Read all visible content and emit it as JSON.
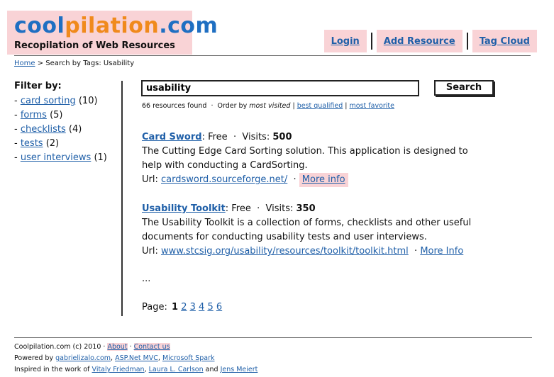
{
  "logo": {
    "part1": "cool",
    "part2": "pilation",
    "part3": ".com",
    "tagline": "Recopilation of Web Resources"
  },
  "nav": {
    "login": "Login",
    "add_resource": "Add Resource",
    "tag_cloud": "Tag Cloud"
  },
  "breadcrumb": {
    "home": "Home",
    "rest": " > Search by Tags: Usability"
  },
  "filter": {
    "title": "Filter by:",
    "items": [
      {
        "label": "card sorting",
        "count": "(10)"
      },
      {
        "label": "forms",
        "count": "(5)"
      },
      {
        "label": "checklists",
        "count": "(4)"
      },
      {
        "label": "tests",
        "count": "(2)"
      },
      {
        "label": "user interviews",
        "count": "(1)"
      }
    ]
  },
  "search": {
    "value": "usability",
    "button": "Search"
  },
  "meta": {
    "found": "66 resources found",
    "order_prefix": "Order by",
    "order_current": "most visited",
    "opt1": "best qualified",
    "opt2": "most favorite"
  },
  "results": [
    {
      "title": "Card Sword",
      "price": "Free",
      "visits_label": "Visits:",
      "visits": "500",
      "desc": "The Cutting Edge Card Sorting solution. This application is designed to help with conducting a CardSorting.",
      "url_label": "Url:",
      "url": "cardsword.sourceforge.net/",
      "more": "More info"
    },
    {
      "title": "Usability Toolkit",
      "price": "Free",
      "visits_label": "Visits:",
      "visits": "350",
      "desc": "The Usability Toolkit is a collection of forms, checklists and other useful documents for conducting usability tests and user interviews.",
      "url_label": "Url:",
      "url": "www.stcsig.org/usability/resources/toolkit/toolkit.html",
      "more": "More Info"
    }
  ],
  "ellipsis": "...",
  "pager": {
    "label": "Page:",
    "current": "1",
    "pages": [
      "2",
      "3",
      "4",
      "5",
      "6"
    ]
  },
  "footer": {
    "copyright": "Coolpilation.com (c) 2010",
    "about": "About",
    "contact": "Contact us",
    "powered_prefix": "Powered by",
    "powered": [
      "gabrielizalo.com",
      "ASP.Net MVC",
      "Microsoft Spark"
    ],
    "inspired_prefix": "Inspired in the work of",
    "inspired": [
      "Vitaly Friedman",
      "Laura L. Carlson",
      "Jens Meiert"
    ],
    "and": "and"
  },
  "colors": {
    "pink": "#f9d3d6",
    "link": "#1f5fa8",
    "brand_blue": "#1f6fc2",
    "brand_orange": "#f08a1c"
  }
}
